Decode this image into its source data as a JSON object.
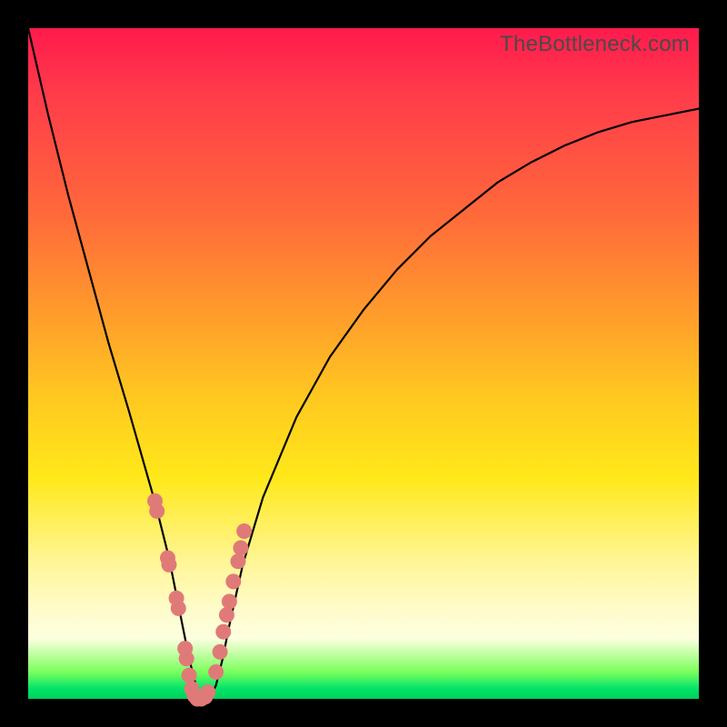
{
  "watermark": "TheBottleneck.com",
  "colors": {
    "frame": "#000000",
    "curve": "#000000",
    "marker": "#e07a78",
    "marker_stroke": "#c96a68"
  },
  "chart_data": {
    "type": "line",
    "title": "",
    "xlabel": "",
    "ylabel": "",
    "xlim": [
      0,
      100
    ],
    "ylim": [
      0,
      100
    ],
    "series": [
      {
        "name": "bottleneck-curve",
        "x": [
          0,
          3,
          6,
          9,
          12,
          15,
          17,
          19,
          20,
          21,
          22,
          23,
          24,
          25,
          26,
          27,
          28,
          29,
          30,
          32,
          35,
          40,
          45,
          50,
          55,
          60,
          65,
          70,
          75,
          80,
          85,
          90,
          95,
          100
        ],
        "y": [
          100,
          87,
          75,
          64,
          53,
          43,
          36,
          29,
          25,
          21,
          16,
          11,
          6,
          2,
          0,
          0,
          2,
          6,
          11,
          20,
          30,
          42,
          51,
          58,
          64,
          69,
          73,
          77,
          80,
          82.5,
          84.5,
          86,
          87,
          88
        ]
      }
    ],
    "annotations": [
      {
        "name": "points-left-branch",
        "x": [
          18.9,
          19.2,
          20.8,
          21.0,
          22.1,
          22.4,
          23.4,
          23.6,
          24.0,
          24.4,
          24.8
        ],
        "y": [
          29.5,
          28.0,
          21.0,
          20.0,
          15.0,
          13.5,
          7.5,
          6.0,
          3.5,
          1.5,
          0.5
        ]
      },
      {
        "name": "points-valley",
        "x": [
          25.2,
          25.8,
          26.4,
          26.8
        ],
        "y": [
          0.0,
          0.0,
          0.3,
          1.0
        ]
      },
      {
        "name": "points-right-branch",
        "x": [
          28.0,
          28.6,
          29.1,
          29.6,
          30.0,
          30.6,
          31.3,
          31.7,
          32.2
        ],
        "y": [
          4.0,
          7.0,
          10.0,
          12.5,
          14.5,
          17.5,
          20.5,
          22.5,
          25.0
        ]
      }
    ]
  }
}
